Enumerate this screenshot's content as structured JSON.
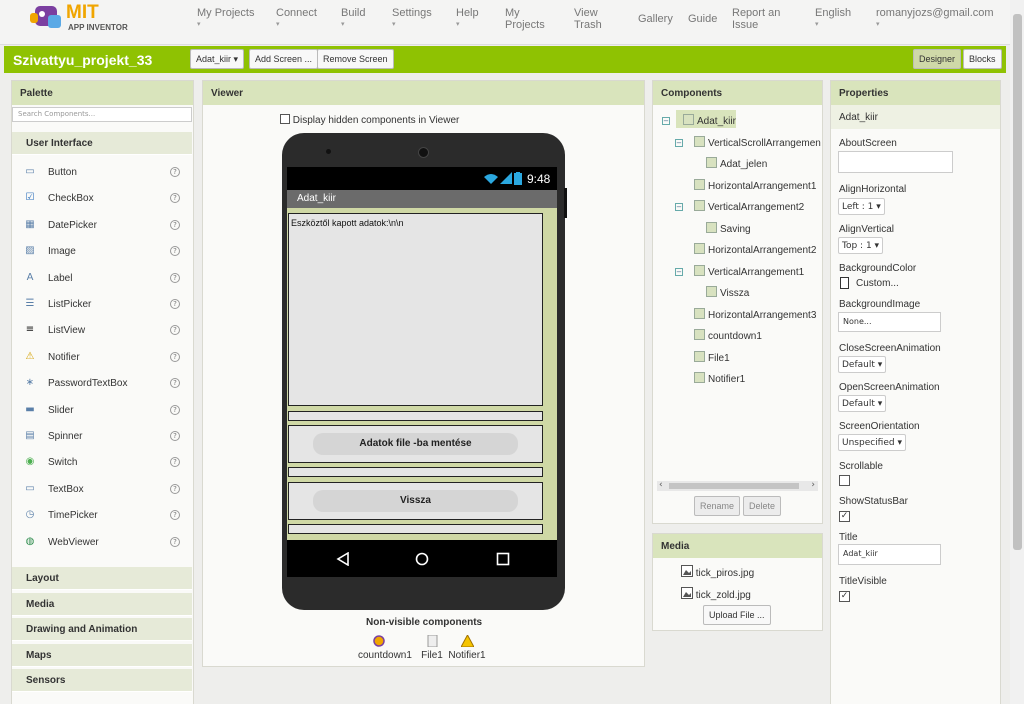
{
  "header": {
    "logo_mit": "MIT",
    "logo_sub": "APP INVENTOR",
    "menu": [
      {
        "label": "My Projects",
        "caret": "▾"
      },
      {
        "label": "Connect",
        "caret": "▾"
      },
      {
        "label": "Build",
        "caret": "▾"
      },
      {
        "label": "Settings",
        "caret": "▾"
      },
      {
        "label": "Help",
        "caret": "▾"
      }
    ],
    "my_projects_1": "My",
    "my_projects_2": "Projects",
    "view_trash_1": "View",
    "view_trash_2": "Trash",
    "gallery": "Gallery",
    "guide": "Guide",
    "report_1": "Report an",
    "report_2": "Issue",
    "language": "English",
    "account": "romanyjozs@gmail.com",
    "caret": "▾"
  },
  "project_bar": {
    "name": "Szivattyu_projekt_33",
    "screen_select": "Adat_kiir ▾",
    "add_screen": "Add Screen ...",
    "remove_screen": "Remove Screen",
    "designer": "Designer",
    "blocks": "Blocks"
  },
  "palette": {
    "title": "Palette",
    "search_placeholder": "Search Components...",
    "open_category": "User Interface",
    "items": [
      {
        "label": "Button",
        "icon": "button-icon"
      },
      {
        "label": "CheckBox",
        "icon": "checkbox-icon"
      },
      {
        "label": "DatePicker",
        "icon": "datepicker-icon"
      },
      {
        "label": "Image",
        "icon": "image-icon"
      },
      {
        "label": "Label",
        "icon": "label-icon"
      },
      {
        "label": "ListPicker",
        "icon": "listpicker-icon"
      },
      {
        "label": "ListView",
        "icon": "listview-icon"
      },
      {
        "label": "Notifier",
        "icon": "notifier-icon"
      },
      {
        "label": "PasswordTextBox",
        "icon": "password-icon"
      },
      {
        "label": "Slider",
        "icon": "slider-icon"
      },
      {
        "label": "Spinner",
        "icon": "spinner-icon"
      },
      {
        "label": "Switch",
        "icon": "switch-icon"
      },
      {
        "label": "TextBox",
        "icon": "textbox-icon"
      },
      {
        "label": "TimePicker",
        "icon": "timepicker-icon"
      },
      {
        "label": "WebViewer",
        "icon": "webviewer-icon"
      }
    ],
    "help_glyph": "?",
    "categories": [
      "Layout",
      "Media",
      "Drawing and Animation",
      "Maps",
      "Sensors"
    ]
  },
  "viewer": {
    "title": "Viewer",
    "hidden_checkbox_label": "Display hidden components in Viewer",
    "time": "9:48",
    "screen_title": "Adat_kiir",
    "label_text": "Eszköztől kapott adatok:\\n\\n",
    "button_save": "Adatok file -ba mentése",
    "button_back": "Vissza",
    "non_visible_title": "Non-visible components",
    "non_visible": [
      "countdown1",
      "File1",
      "Notifier1"
    ]
  },
  "components": {
    "title": "Components",
    "tree": [
      {
        "label": "Adat_kiir",
        "level": 0,
        "toggle": "−",
        "selected": true
      },
      {
        "label": "VerticalScrollArrangemen",
        "level": 1,
        "toggle": "−"
      },
      {
        "label": "Adat_jelen",
        "level": 2,
        "toggle": ""
      },
      {
        "label": "HorizontalArrangement1",
        "level": 1,
        "toggle": ""
      },
      {
        "label": "VerticalArrangement2",
        "level": 1,
        "toggle": "−"
      },
      {
        "label": "Saving",
        "level": 2,
        "toggle": ""
      },
      {
        "label": "HorizontalArrangement2",
        "level": 1,
        "toggle": ""
      },
      {
        "label": "VerticalArrangement1",
        "level": 1,
        "toggle": "−"
      },
      {
        "label": "Vissza",
        "level": 2,
        "toggle": ""
      },
      {
        "label": "HorizontalArrangement3",
        "level": 1,
        "toggle": ""
      },
      {
        "label": "countdown1",
        "level": 1,
        "toggle": ""
      },
      {
        "label": "File1",
        "level": 1,
        "toggle": ""
      },
      {
        "label": "Notifier1",
        "level": 1,
        "toggle": ""
      }
    ],
    "rename": "Rename",
    "delete": "Delete"
  },
  "media": {
    "title": "Media",
    "files": [
      "tick_piros.jpg",
      "tick_zold.jpg"
    ],
    "upload": "Upload File ..."
  },
  "properties": {
    "title": "Properties",
    "component": "Adat_kiir",
    "about_screen": "AboutScreen",
    "align_horizontal": "AlignHorizontal",
    "align_horizontal_value": "Left : 1 ▾",
    "align_vertical": "AlignVertical",
    "align_vertical_value": "Top : 1 ▾",
    "background_color": "BackgroundColor",
    "background_color_value": "Custom...",
    "background_image": "BackgroundImage",
    "background_image_value": "None...",
    "close_anim": "CloseScreenAnimation",
    "close_anim_value": "Default ▾",
    "open_anim": "OpenScreenAnimation",
    "open_anim_value": "Default ▾",
    "orientation": "ScreenOrientation",
    "orientation_value": "Unspecified ▾",
    "scrollable": "Scrollable",
    "show_status_bar": "ShowStatusBar",
    "title_label": "Title",
    "title_value": "Adat_kiir",
    "title_visible": "TitleVisible",
    "check": "✓"
  }
}
